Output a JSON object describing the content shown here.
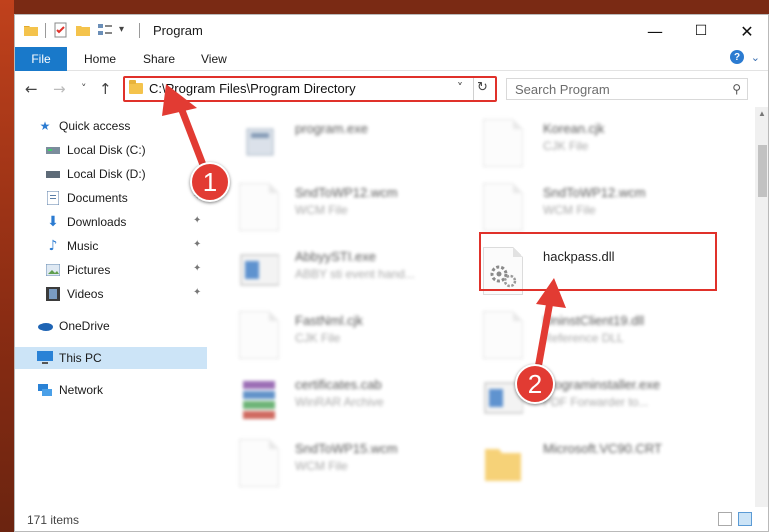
{
  "window": {
    "title": "Program",
    "controls": {
      "minimize": "—",
      "maximize": "☐",
      "close": "✕"
    }
  },
  "ribbon": {
    "tabs": [
      "File",
      "Home",
      "Share",
      "View"
    ],
    "help": "?"
  },
  "navigation": {
    "back": "←",
    "forward": "→",
    "recent": "˅",
    "up": "↑",
    "address": "C:\\Program Files\\Program Directory",
    "address_dropdown": "˅",
    "refresh": "↻",
    "search_placeholder": "Search Program"
  },
  "sidebar": {
    "items": [
      {
        "label": "Quick access",
        "icon": "star-icon"
      },
      {
        "label": "Local Disk (C:)",
        "icon": "drive-icon"
      },
      {
        "label": "Local Disk (D:)",
        "icon": "drive-icon"
      },
      {
        "label": "Documents",
        "icon": "documents-icon",
        "pinned": true
      },
      {
        "label": "Downloads",
        "icon": "download-icon",
        "pinned": true
      },
      {
        "label": "Music",
        "icon": "music-icon",
        "pinned": true
      },
      {
        "label": "Pictures",
        "icon": "pictures-icon",
        "pinned": true
      },
      {
        "label": "Videos",
        "icon": "videos-icon",
        "pinned": true
      },
      {
        "label": "OneDrive",
        "icon": "cloud-icon"
      },
      {
        "label": "This PC",
        "icon": "computer-icon",
        "selected": true
      },
      {
        "label": "Network",
        "icon": "network-icon"
      }
    ],
    "pin_glyph": "📌"
  },
  "files": {
    "left_column": [
      {
        "name": "program.exe",
        "type": ""
      },
      {
        "name": "SndToWP12.wcm",
        "type": "WCM File"
      },
      {
        "name": "AbbyySTI.exe",
        "type": "ABBY sti event hand..."
      },
      {
        "name": "FastNml.cjk",
        "type": "CJK File"
      },
      {
        "name": "certificates.cab",
        "type": "WinRAR Archive"
      },
      {
        "name": "SndToWP15.wcm",
        "type": "WCM File"
      }
    ],
    "right_column": [
      {
        "name": "Korean.cjk",
        "type": "CJK File"
      },
      {
        "name": "SndToWP12.wcm",
        "type": "WCM File"
      },
      {
        "name": "hackpass.dll",
        "type": ""
      },
      {
        "name": "UninstClient19.dll",
        "type": "Reference DLL"
      },
      {
        "name": "programinstaller.exe",
        "type": "PDF Forwarder to..."
      },
      {
        "name": "Microsoft.VC90.CRT",
        "type": ""
      }
    ]
  },
  "status": {
    "item_count": "171 items"
  },
  "annotations": {
    "step1": "1",
    "step2": "2"
  },
  "colors": {
    "accent": "#1979ca",
    "highlight": "#e0312a",
    "selected": "#cce4f7"
  }
}
